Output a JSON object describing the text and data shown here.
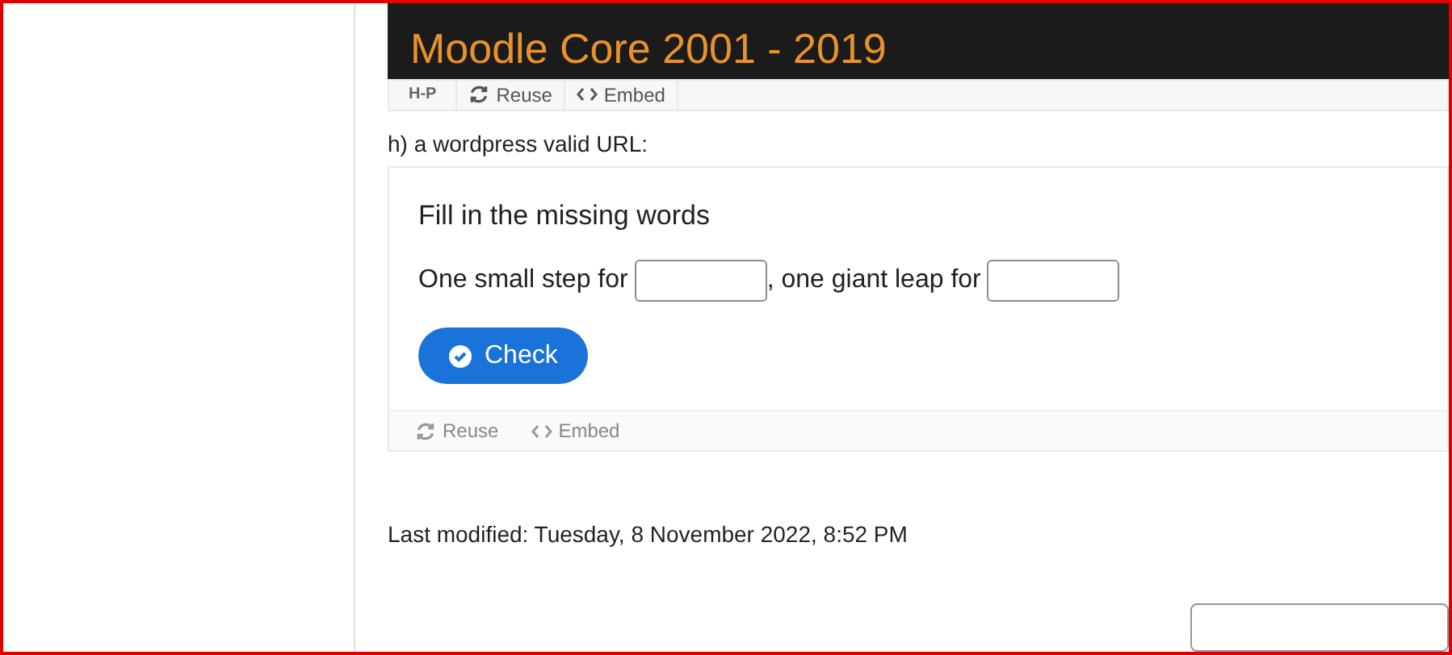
{
  "banner": {
    "title": "Moodle Core 2001 - 2019"
  },
  "banner_toolbar": {
    "logo": "H-P",
    "actions": [
      "Reuse",
      "Embed"
    ]
  },
  "question_label": "h) a wordpress valid URL:",
  "activity": {
    "title": "Fill in the missing words",
    "segments": [
      {
        "kind": "text",
        "text": "One small step for"
      },
      {
        "kind": "blank"
      },
      {
        "kind": "text",
        "text": ", one giant leap for"
      },
      {
        "kind": "blank"
      }
    ],
    "check_button": "Check",
    "footer_actions": [
      "Reuse",
      "Embed"
    ]
  },
  "last_modified": "Last modified: Tuesday, 8 November 2022, 8:52 PM"
}
